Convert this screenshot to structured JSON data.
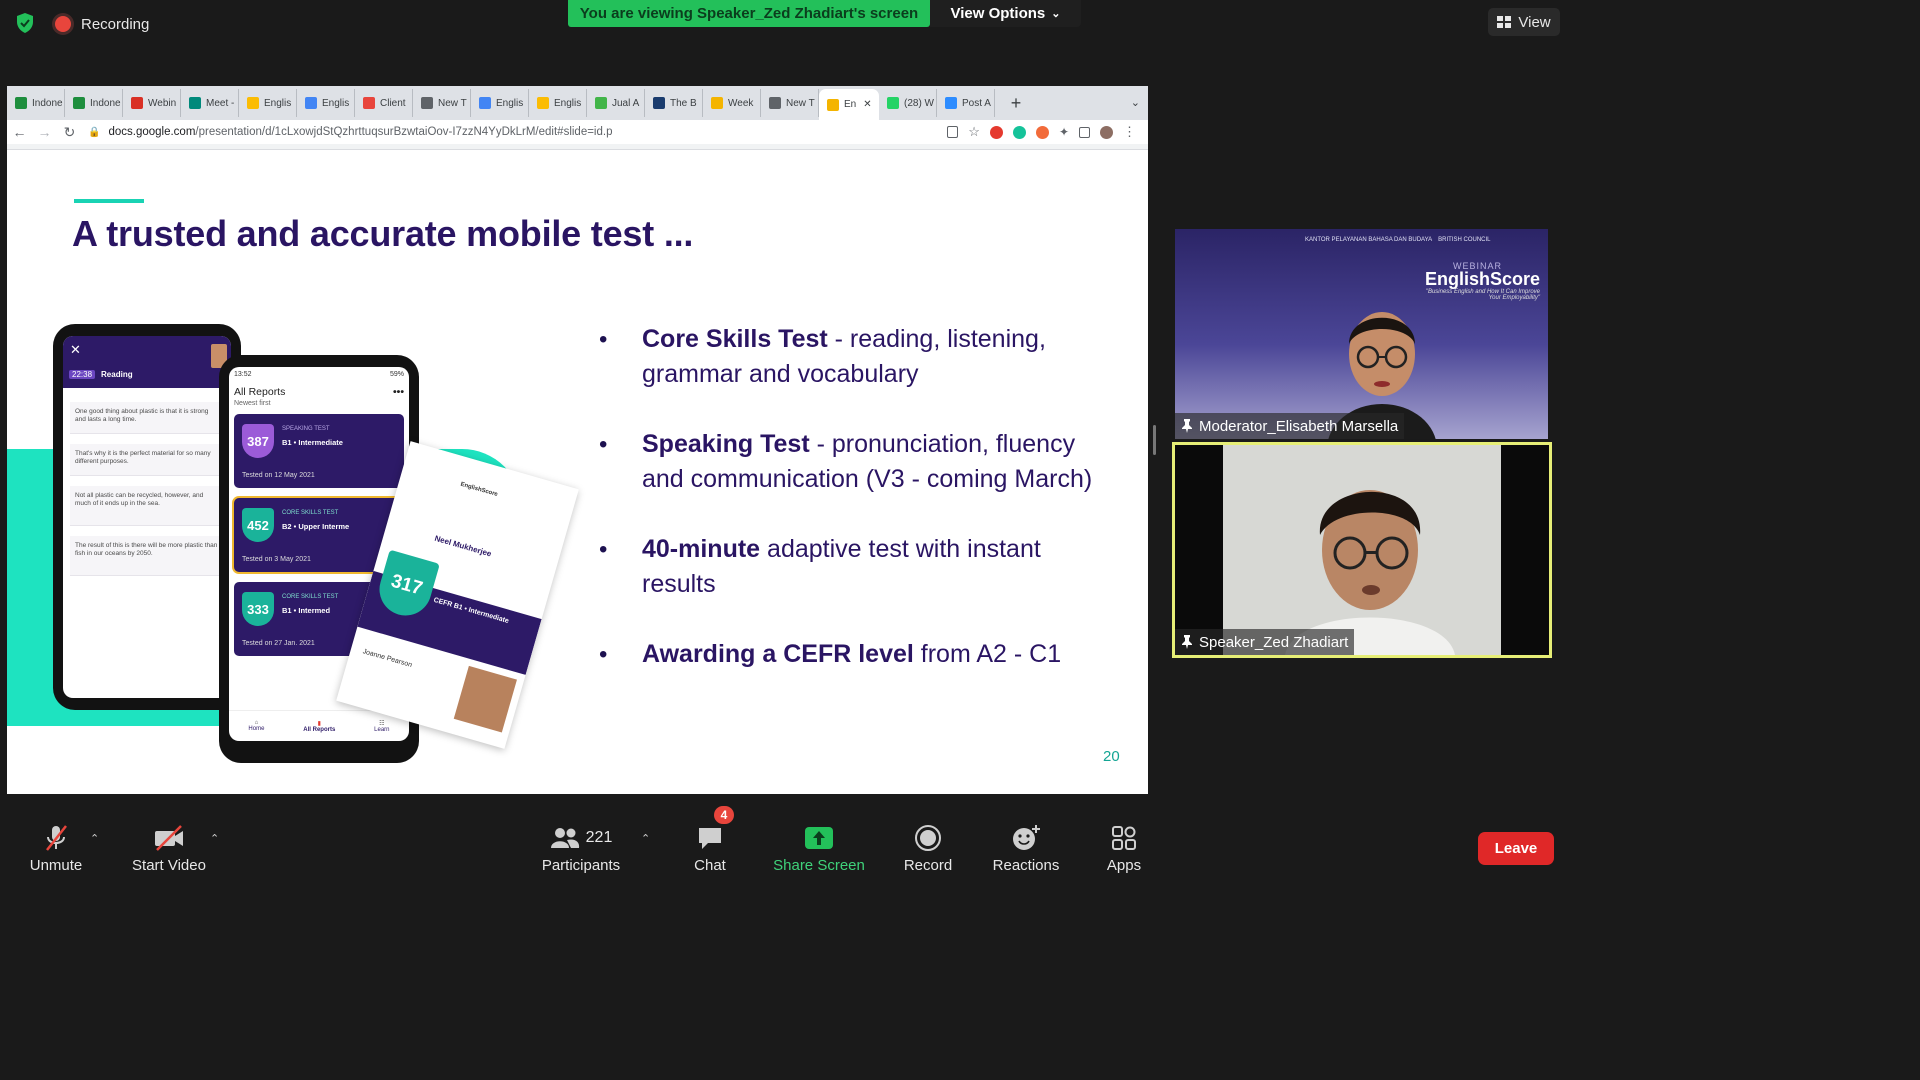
{
  "top_bar": {
    "recording_label": "Recording",
    "viewing_banner": "You are viewing Speaker_Zed Zhadiart's screen",
    "view_options_label": "View Options",
    "view_label": "View",
    "colors": {
      "banner_green": "#23c05a",
      "record_red": "#e8453c"
    }
  },
  "browser": {
    "tabs": [
      {
        "label": "Indone",
        "icon": "google-sheets-icon",
        "color": "#1e8e3e"
      },
      {
        "label": "Indone",
        "icon": "google-sheets-icon",
        "color": "#1e8e3e"
      },
      {
        "label": "Webin",
        "icon": "gmail-icon",
        "color": "#d93025"
      },
      {
        "label": "Meet -",
        "icon": "google-meet-icon",
        "color": "#00897b"
      },
      {
        "label": "Englis",
        "icon": "google-drive-icon",
        "color": "#fbbc04"
      },
      {
        "label": "Englis",
        "icon": "google-calendar-icon",
        "color": "#4285f4"
      },
      {
        "label": "Client",
        "icon": "generic-page-icon",
        "color": "#e8453c"
      },
      {
        "label": "New T",
        "icon": "generic-page-icon",
        "color": "#5f6368"
      },
      {
        "label": "Englis",
        "icon": "google-calendar-icon",
        "color": "#4285f4"
      },
      {
        "label": "Englis",
        "icon": "google-drive-icon",
        "color": "#fbbc04"
      },
      {
        "label": "Jual A",
        "icon": "tokopedia-icon",
        "color": "#42b549"
      },
      {
        "label": "The B",
        "icon": "generic-page-icon",
        "color": "#1a3c6e"
      },
      {
        "label": "Week",
        "icon": "google-slides-icon",
        "color": "#f4b400"
      },
      {
        "label": "New T",
        "icon": "generic-page-icon",
        "color": "#5f6368"
      },
      {
        "label": "En",
        "icon": "google-slides-icon",
        "color": "#f4b400",
        "active": true
      },
      {
        "label": "(28) W",
        "icon": "whatsapp-icon",
        "color": "#25d366"
      },
      {
        "label": "Post A",
        "icon": "zoom-icon",
        "color": "#2d8cff"
      }
    ],
    "url_host": "docs.google.com",
    "url_path": "/presentation/d/1cLxowjdStQzhrttuqsurBzwtaiOov-I7zzN4YyDkLrM/edit#slide=id.p"
  },
  "slide": {
    "title": "A trusted and accurate mobile test ...",
    "bullets": [
      {
        "bold": "Core Skills Test",
        "rest": " - reading, listening, grammar and vocabulary"
      },
      {
        "bold": "Speaking Test",
        "rest": " - pronunciation, fluency and communication (V3 - coming March)"
      },
      {
        "bold": "40-minute",
        "rest": " adaptive test with instant results"
      },
      {
        "bold": "Awarding a CEFR level",
        "rest": " from A2 - C1"
      }
    ],
    "page_number": "20",
    "phone_left": {
      "timer": "22:38",
      "section": "Reading",
      "items": [
        "One good thing about plastic is that it is strong and lasts a long time.",
        "That's why it is the perfect material for so many different purposes.",
        "Not all plastic can be recycled, however, and much of it ends up in the sea.",
        "The result of this is there will be more plastic than fish in our oceans by 2050."
      ]
    },
    "phone_right": {
      "status_time": "13:52",
      "status_battery": "59%",
      "title": "All Reports",
      "subtitle": "Newest first",
      "reports": [
        {
          "score": "387",
          "type": "SPEAKING TEST",
          "level": "B1 • Intermediate",
          "date": "Tested on 12 May 2021"
        },
        {
          "score": "452",
          "type": "CORE SKILLS TEST",
          "level": "B2 • Upper Interme",
          "date": "Tested on 3 May 2021"
        },
        {
          "score": "333",
          "type": "CORE SKILLS TEST",
          "level": "B1 • Intermed",
          "date": "Tested on 27 Jan. 2021"
        }
      ],
      "nav": [
        "Home",
        "All Reports",
        "Learn"
      ]
    },
    "certificate": {
      "brand": "EnglishScore",
      "name": "Neel Mukherjee",
      "score": "317",
      "level": "CEFR B1 • Intermediate",
      "signature": "Joanne Pearson"
    }
  },
  "videos": {
    "moderator": {
      "name": "Moderator_Elisabeth Marsella",
      "backdrop_webinar": "WEBINAR",
      "backdrop_brand": "EnglishScore",
      "backdrop_tagline": "\"Business English and How It Can Improve Your Employability\"",
      "backdrop_logo_left": "KANTOR PELAYANAN BAHASA DAN BUDAYA",
      "backdrop_logo_right": "BRITISH COUNCIL"
    },
    "speaker": {
      "name": "Speaker_Zed Zhadiart",
      "highlight_color": "#e6ee76"
    }
  },
  "toolbar": {
    "unmute": "Unmute",
    "start_video": "Start Video",
    "participants": "Participants",
    "participants_count": "221",
    "chat": "Chat",
    "chat_badge": "4",
    "share_screen": "Share Screen",
    "record": "Record",
    "reactions": "Reactions",
    "apps": "Apps",
    "leave": "Leave"
  }
}
